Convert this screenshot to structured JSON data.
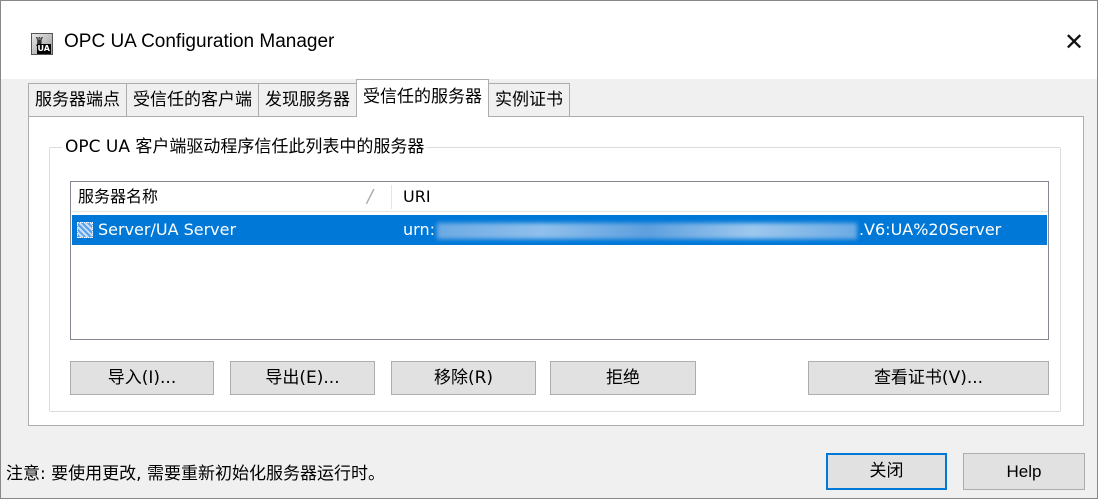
{
  "window": {
    "title": "OPC UA Configuration Manager",
    "close_symbol": "✕"
  },
  "tabs": [
    {
      "label": "服务器端点"
    },
    {
      "label": "受信任的客户端"
    },
    {
      "label": "发现服务器"
    },
    {
      "label": "受信任的服务器",
      "active": true
    },
    {
      "label": "实例证书"
    }
  ],
  "group": {
    "title": "OPC UA 客户端驱动程序信任此列表中的服务器"
  },
  "list": {
    "columns": [
      "服务器名称",
      "URI"
    ],
    "sort_indicator": "/",
    "rows": [
      {
        "name": "Server/UA Server",
        "uri_prefix": "urn:",
        "uri_suffix": ".V6:UA%20Server",
        "selected": true
      }
    ]
  },
  "buttons": {
    "import": "导入(I)...",
    "export": "导出(E)...",
    "remove": "移除(R)",
    "reject": "拒绝",
    "view_cert": "查看证书(V)..."
  },
  "footer": {
    "note": "注意: 要使用更改, 需要重新初始化服务器运行时。",
    "close": "关闭",
    "help": "Help"
  },
  "colors": {
    "selection": "#0078d7",
    "button_face": "#e1e1e1",
    "default_button_border": "#0078d7"
  }
}
